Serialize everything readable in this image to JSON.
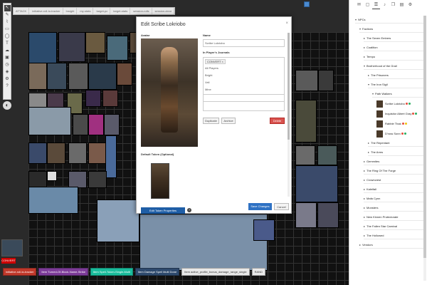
{
  "macros_top": [
    "ATTACK",
    "initiative-roll-to-tracker",
    "Insight",
    "my-stats",
    "target-pc",
    "target-stats",
    "session-rolls",
    "session-clear"
  ],
  "tools": [
    "pointer-icon",
    "pencil-icon",
    "brush-icon",
    "ruler-icon",
    "shape-icon",
    "text-icon",
    "fog-icon",
    "cube-icon",
    "clock-icon",
    "dice-icon",
    "gear-icon",
    "help-icon"
  ],
  "gm_label": "CONVERT",
  "macros_bottom": [
    {
      "label": "initiative-roll-to-tracker",
      "color": "#c0392b"
    },
    {
      "label": "Item Turned-Of-Block-Name-Strike",
      "color": "#7d3c98"
    },
    {
      "label": "Item Spell-Token-Single-Multi",
      "color": "#1abc9c"
    },
    {
      "label": "Item Damage Spell Multi Done",
      "color": "#2e4a6e"
    },
    {
      "label": "Item active_profile_bonus_damage_range_single",
      "color": "#e8e8e8"
    },
    {
      "label": "RAND",
      "color": "#e8e8e8"
    }
  ],
  "modal": {
    "title": "Edit Scribe Lokriobo",
    "close": "×",
    "avatar_label": "Avatar",
    "name_label": "Name",
    "name_value": "Scribe Lokriobo",
    "journals_label": "In Player's Journals",
    "journal_tag": "CONVERT ×",
    "journal_options": [
      "All Players",
      "Bright",
      "Veil",
      "Mine"
    ],
    "edited_by_value": "",
    "duplicate": "Duplicate",
    "archive": "Archive",
    "delete": "Delete",
    "default_token_label": "Default Token (Optional)",
    "edit_token": "Edit Token Properties",
    "help": "?",
    "save": "Save Changes",
    "cancel": "Cancel"
  },
  "sidebar": {
    "tabs": [
      "chat-icon",
      "image-icon",
      "journal-icon",
      "music-icon",
      "compendium-icon",
      "deck-icon",
      "settings-icon"
    ],
    "tree": [
      {
        "label": "NPCs",
        "level": 0,
        "arrow": "▾"
      },
      {
        "label": "Factions",
        "level": 1,
        "arrow": "▾"
      },
      {
        "label": "The Seven Embers",
        "level": 2,
        "arrow": "▸"
      },
      {
        "label": "Coalition",
        "level": 2,
        "arrow": "▸"
      },
      {
        "label": "Tempo",
        "level": 2,
        "arrow": "▸"
      },
      {
        "label": "Brotherhood of the Grail",
        "level": 2,
        "arrow": "▾"
      },
      {
        "label": "The Prisoners",
        "level": 3,
        "arrow": "▸"
      },
      {
        "label": "The Iron Sigil",
        "level": 3,
        "arrow": "▾"
      },
      {
        "label": "Path Walkers",
        "level": 4,
        "arrow": "▾"
      }
    ],
    "characters": [
      {
        "name": "Scribe Lokriobo",
        "dots": [
          "#e74c3c",
          "#27ae60"
        ]
      },
      {
        "name": "Inquisitor Albert Gray",
        "dots": [
          "#e74c3c",
          "#27ae60"
        ]
      },
      {
        "name": "Rabble Thak",
        "dots": [
          "#e74c3c",
          "#f1c40f"
        ]
      },
      {
        "name": "D'ross Sonn",
        "dots": [
          "#e74c3c",
          "#27ae60"
        ]
      }
    ],
    "tree_after": [
      {
        "label": "The Repentant",
        "level": 3,
        "arrow": "▸"
      },
      {
        "label": "The Arms",
        "level": 3,
        "arrow": "▸"
      },
      {
        "label": "Gemmites",
        "level": 2,
        "arrow": "▸"
      },
      {
        "label": "The Ring Of The Forge",
        "level": 2,
        "arrow": "▸"
      },
      {
        "label": "Crowncrest",
        "level": 2,
        "arrow": "▸"
      },
      {
        "label": "Kaleifall",
        "level": 2,
        "arrow": "▸"
      },
      {
        "label": "Mafa Cynn",
        "level": 2,
        "arrow": "▸"
      },
      {
        "label": "Monsters",
        "level": 2,
        "arrow": "▸"
      },
      {
        "label": "New Kinnen Protectorate",
        "level": 2,
        "arrow": "▸"
      },
      {
        "label": "The Fallen Star Carnival",
        "level": 2,
        "arrow": "▸"
      },
      {
        "label": "The Hollowed",
        "level": 2,
        "arrow": "▸"
      },
      {
        "label": "Vendors",
        "level": 1,
        "arrow": "▸"
      }
    ]
  }
}
